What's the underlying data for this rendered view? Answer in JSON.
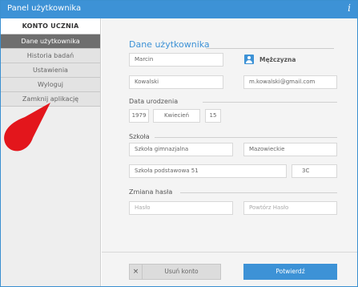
{
  "window": {
    "title": "Panel użytkownika",
    "info_glyph": "i"
  },
  "sidebar": {
    "header": "KONTO UCZNIA",
    "items": [
      {
        "label": "Dane użytkownika",
        "active": true
      },
      {
        "label": "Historia badań",
        "active": false
      },
      {
        "label": "Ustawienia",
        "active": false
      },
      {
        "label": "Wyloguj",
        "active": false
      },
      {
        "label": "Zamknij aplikację",
        "active": false
      }
    ]
  },
  "main": {
    "title": "Dane użytkownika",
    "first_name": "Marcin",
    "last_name": "Kowalski",
    "email": "m.kowalski@gmail.com",
    "gender": "Mężczyzna",
    "birth": {
      "label": "Data urodzenia",
      "year": "1979",
      "month": "Kwiecień",
      "day": "15"
    },
    "school": {
      "label": "Szkoła",
      "type": "Szkoła gimnazjalna",
      "region": "Mazowieckie",
      "name": "Szkoła podstawowa 51",
      "class": "3C"
    },
    "password": {
      "label": "Zmiana hasła",
      "placeholder": "Hasło",
      "repeat_placeholder": "Powtórz Hasło"
    },
    "delete_button": "Usuń konto",
    "delete_icon": "×",
    "confirm_button": "Potwierdź"
  },
  "colors": {
    "accent": "#3d92d6",
    "active_item": "#6e6e6e",
    "marker": "#e3161c"
  }
}
